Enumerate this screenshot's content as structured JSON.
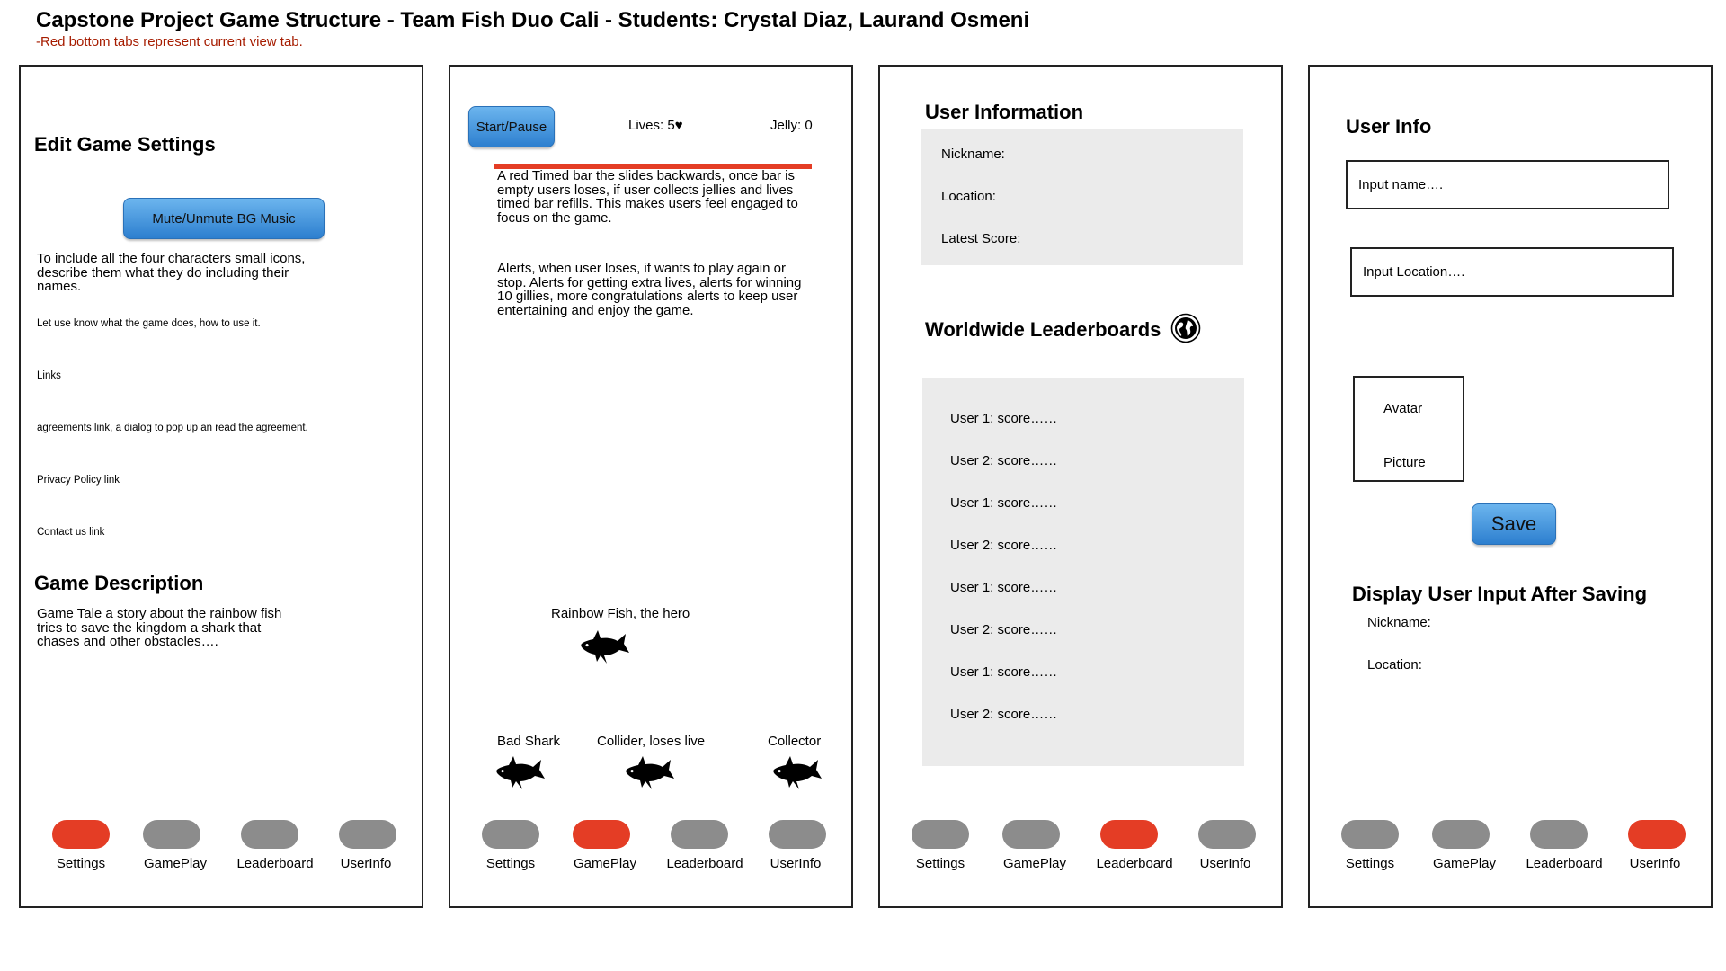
{
  "header": {
    "title": "Capstone Project Game Structure - Team Fish Duo Cali - Students: Crystal Diaz, Laurand Osmeni",
    "subtitle": "-Red bottom tabs represent current view tab."
  },
  "tabs": [
    "Settings",
    "GamePlay",
    "Leaderboard",
    "UserInfo"
  ],
  "settings": {
    "heading": "Edit Game Settings",
    "mute_button": "Mute/Unmute BG Music",
    "characters_note": "To include all the four characters small icons, describe them what they do including their names.",
    "usage_note": "Let use know what the game does, how to use it.",
    "links": "Links",
    "agreements": "agreements link, a dialog to pop up an read the agreement.",
    "privacy": "Privacy Policy link",
    "contact": "Contact us link",
    "description_heading": "Game Description",
    "description": "Game Tale a story about the rainbow fish tries to save the kingdom a shark that chases and other obstacles….",
    "active_tab": "Settings"
  },
  "gameplay": {
    "start_pause": "Start/Pause",
    "lives_label": "Lives: 5",
    "heart": "♥",
    "jelly_label": "Jelly: 0",
    "timed_bar_note": "A red Timed bar the slides backwards, once bar is empty users loses, if user collects jellies and lives timed bar refills. This makes users feel engaged to focus on the game.",
    "alerts_note": "Alerts, when user loses, if wants to play again or stop. Alerts for getting extra lives, alerts for winning 10 gillies, more congratulations alerts to keep user entertaining and enjoy the game.",
    "hero_label": "Rainbow Fish, the hero",
    "shark_label": "Bad Shark",
    "collider_label": "Collider, loses live",
    "collector_label": "Collector",
    "bar_color": "#e43d25",
    "active_tab": "GamePlay"
  },
  "leaderboard": {
    "user_info_heading": "User Information",
    "nickname_label": "Nickname:",
    "location_label": "Location:",
    "latest_score_label": "Latest Score:",
    "worldwide_heading": "Worldwide Leaderboards",
    "globe_icon": "globe-icon",
    "rows": [
      "User 1: score……",
      "User 2: score……",
      "User 1: score……",
      "User 2: score……",
      "User 1: score……",
      "User 2: score……",
      "User 1: score……",
      "User 2: score……"
    ],
    "active_tab": "Leaderboard"
  },
  "userinfo": {
    "heading": "User Info",
    "name_placeholder": "Input name….",
    "location_placeholder": "Input Location….",
    "avatar_line1": "Avatar",
    "avatar_line2": "Picture",
    "save_button": "Save",
    "display_heading": "Display User Input After Saving",
    "nickname_label": "Nickname:",
    "location_label": "Location:",
    "active_tab": "UserInfo"
  },
  "colors": {
    "active_tab": "#e43d25",
    "inactive_tab": "#8c8c8c",
    "button_blue": "#4a9be0",
    "info_box": "#ebebeb",
    "subtitle_red": "#a61c00"
  }
}
